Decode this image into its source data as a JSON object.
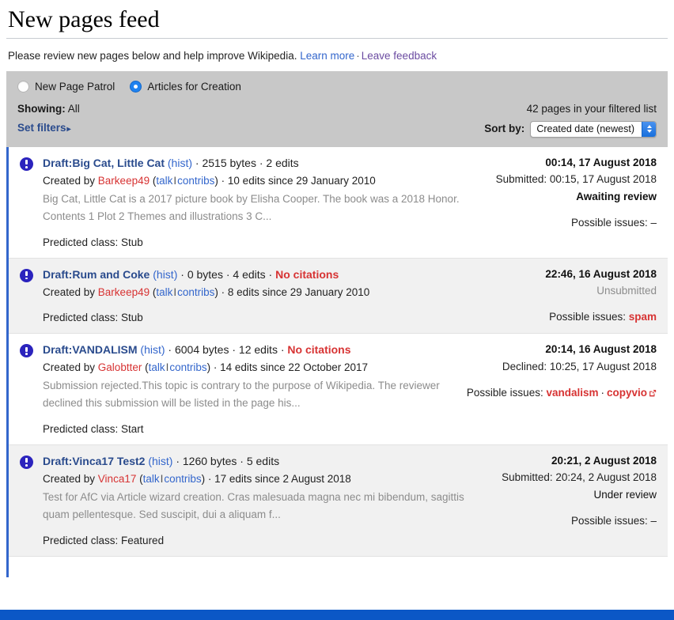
{
  "header": {
    "title": "New pages feed",
    "intro_text": "Please review new pages below and help improve Wikipedia.",
    "learn_more": "Learn more",
    "separator": "·",
    "leave_feedback": "Leave feedback"
  },
  "controls": {
    "radio_new_page_patrol": "New Page Patrol",
    "radio_articles_for_creation": "Articles for Creation",
    "selected_mode": "Articles for Creation",
    "showing_label": "Showing:",
    "showing_value": "All",
    "set_filters": "Set filters",
    "set_filters_caret": "▸",
    "count_text": "42 pages in your filtered list",
    "sort_label": "Sort by:",
    "sort_value": "Created date (newest)"
  },
  "feed": {
    "rows": [
      {
        "alert_icon": "alert-icon",
        "title": "Draft:Big Cat, Little Cat",
        "hist": "(hist)",
        "bytes": "2515 bytes",
        "edits": "2 edits",
        "citations_flag": "",
        "created_by_label": "Created by",
        "user": "Barkeep49",
        "talk": "talk",
        "contribs": "contribs",
        "user_edits": "10 edits since 29 January 2010",
        "snippet": "Big Cat, Little Cat is a 2017 picture book by Elisha Cooper. The book was a 2018 Honor. Contents 1 Plot 2 Themes and illustrations 3 C...",
        "predicted_label": "Predicted class:",
        "predicted_value": "Stub",
        "date": "00:14, 17 August 2018",
        "submitted": "Submitted: 00:15, 17 August 2018",
        "state": "Awaiting review",
        "issues_label": "Possible issues:",
        "issues": [],
        "issues_none": "–"
      },
      {
        "alert_icon": "alert-icon",
        "title": "Draft:Rum and Coke",
        "hist": "(hist)",
        "bytes": "0 bytes",
        "edits": "4 edits",
        "citations_flag": "No citations",
        "created_by_label": "Created by",
        "user": "Barkeep49",
        "talk": "talk",
        "contribs": "contribs",
        "user_edits": "8 edits since 29 January 2010",
        "snippet": "",
        "predicted_label": "Predicted class:",
        "predicted_value": "Stub",
        "date": "22:46, 16 August 2018",
        "submitted": "",
        "state": "Unsubmitted",
        "issues_label": "Possible issues:",
        "issues": [
          {
            "label": "spam",
            "external": false
          }
        ],
        "issues_none": ""
      },
      {
        "alert_icon": "alert-icon",
        "title": "Draft:VANDALISM",
        "hist": "(hist)",
        "bytes": "6004 bytes",
        "edits": "12 edits",
        "citations_flag": "No citations",
        "created_by_label": "Created by",
        "user": "Galobtter",
        "talk": "talk",
        "contribs": "contribs",
        "user_edits": "14 edits since 22 October 2017",
        "snippet": "Submission rejected.This topic is contrary to the purpose of Wikipedia. The reviewer declined this submission will be listed in the page his...",
        "predicted_label": "Predicted class:",
        "predicted_value": "Start",
        "date": "20:14, 16 August 2018",
        "submitted": "Declined: 10:25, 17 August 2018",
        "state": "",
        "issues_label": "Possible issues:",
        "issues": [
          {
            "label": "vandalism",
            "external": false
          },
          {
            "label": "copyvio",
            "external": true
          }
        ],
        "issues_none": ""
      },
      {
        "alert_icon": "alert-icon",
        "title": "Draft:Vinca17 Test2",
        "hist": "(hist)",
        "bytes": "1260 bytes",
        "edits": "5 edits",
        "citations_flag": "",
        "created_by_label": "Created by",
        "user": "Vinca17",
        "talk": "talk",
        "contribs": "contribs",
        "user_edits": "17 edits since 2 August 2018",
        "snippet": "Test for AfC via Article wizard creation. Cras malesuada magna nec mi bibendum, sagittis quam pellentesque. Sed suscipit, dui a aliquam f...",
        "predicted_label": "Predicted class:",
        "predicted_value": "Featured",
        "date": "20:21, 2 August 2018",
        "submitted": "Submitted: 20:24, 2 August 2018",
        "state": "Under review",
        "issues_label": "Possible issues:",
        "issues": [],
        "issues_none": "–"
      }
    ]
  },
  "colors": {
    "link_blue": "#3366cc",
    "link_dark_blue": "#2a4b8d",
    "link_visited": "#6b4ba1",
    "red": "#d73333",
    "alert_icon": "#2b23bd",
    "panel_gray": "#c8c8c8",
    "bottom_bar": "#0b57c6",
    "feed_border": "#3366cc"
  }
}
